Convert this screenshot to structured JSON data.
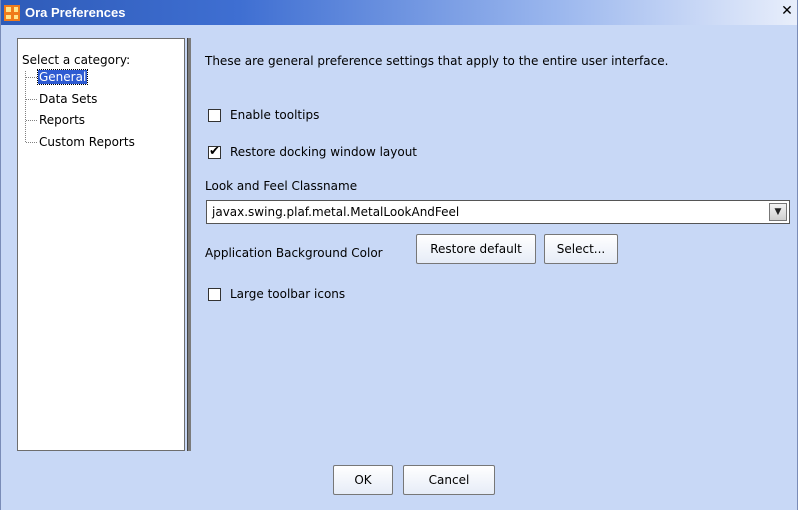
{
  "window": {
    "title": "Ora Preferences",
    "close_symbol": "✕"
  },
  "sidebar": {
    "heading": "Select a category:",
    "items": [
      {
        "label": "General",
        "selected": true
      },
      {
        "label": "Data Sets",
        "selected": false
      },
      {
        "label": "Reports",
        "selected": false
      },
      {
        "label": "Custom Reports",
        "selected": false
      }
    ]
  },
  "general": {
    "description": "These are general preference settings that apply to the entire user interface.",
    "enable_tooltips": {
      "label": "Enable tooltips",
      "checked": false
    },
    "restore_docking": {
      "label": "Restore docking window layout",
      "checked": true
    },
    "laf_label": "Look and Feel Classname",
    "laf_value": "javax.swing.plaf.metal.MetalLookAndFeel",
    "bg_color_label": "Application Background Color",
    "restore_default_label": "Restore default",
    "select_label": "Select...",
    "large_icons": {
      "label": "Large toolbar icons",
      "checked": false
    }
  },
  "footer": {
    "ok_label": "OK",
    "cancel_label": "Cancel"
  },
  "colors": {
    "panel_bg": "#c8d8f6",
    "selection": "#2e5bd2",
    "app_icon": "#f07b1b"
  },
  "icons": [
    "app-icon",
    "close-icon",
    "checkmark-icon",
    "dropdown-arrow-icon"
  ]
}
